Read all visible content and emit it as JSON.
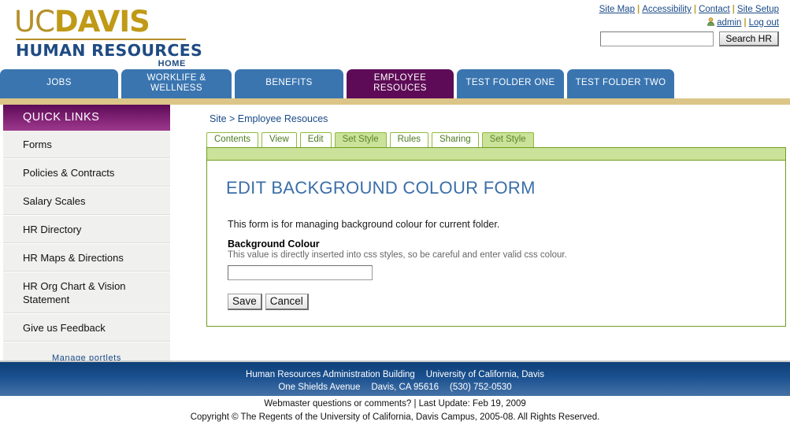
{
  "header": {
    "logo": {
      "uc": "UC",
      "davis": "DAVIS",
      "unit": "HUMAN RESOURCES",
      "home": "HOME"
    },
    "util_links_row1": [
      {
        "label": "Site Map"
      },
      {
        "label": "Accessibility"
      },
      {
        "label": "Contact"
      },
      {
        "label": "Site Setup"
      }
    ],
    "util_links_row2": [
      {
        "label": "admin",
        "icon": "user-icon"
      },
      {
        "label": "Log out"
      }
    ],
    "search": {
      "value": "",
      "placeholder": "",
      "button_label": "Search HR"
    }
  },
  "main_nav": {
    "tabs": [
      {
        "label": "JOBS",
        "active": false
      },
      {
        "label": "WORKLIFE &\nWELLNESS",
        "active": false
      },
      {
        "label": "BENEFITS",
        "active": false
      },
      {
        "label": "EMPLOYEE\nRESOUCES",
        "active": true
      },
      {
        "label": "TEST FOLDER ONE",
        "active": false
      },
      {
        "label": "TEST FOLDER TWO",
        "active": false
      }
    ]
  },
  "sidebar": {
    "title": "QUICK LINKS",
    "items": [
      {
        "label": "Forms"
      },
      {
        "label": "Policies & Contracts"
      },
      {
        "label": "Salary Scales"
      },
      {
        "label": "HR Directory"
      },
      {
        "label": "HR Maps & Directions"
      },
      {
        "label": "HR Org Chart & Vision Statement"
      },
      {
        "label": "Give us Feedback"
      }
    ],
    "manage_portlets": "Manage portlets"
  },
  "content": {
    "breadcrumb": "Site > Employee Resouces",
    "tabs": [
      {
        "label": "Contents",
        "selected": false
      },
      {
        "label": "View",
        "selected": false
      },
      {
        "label": "Edit",
        "selected": false
      },
      {
        "label": "Set Style",
        "selected": true
      },
      {
        "label": "Rules",
        "selected": false
      },
      {
        "label": "Sharing",
        "selected": false
      },
      {
        "label": "Set Style",
        "selected": true
      }
    ],
    "form": {
      "title": "EDIT BACKGROUND COLOUR FORM",
      "intro": "This form is for managing background colour for current folder.",
      "field_label": "Background Colour",
      "field_help": "This value is directly inserted into css styles, so be careful and enter valid css colour.",
      "field_value": "",
      "field_placeholder": "",
      "save_label": "Save",
      "cancel_label": "Cancel"
    }
  },
  "footer": {
    "line1a": "Human Resources Administration Building",
    "line1b": "University of California, Davis",
    "line2a": "One Shields Avenue",
    "line2b": "Davis, CA 95616",
    "line2c": "(530) 752-0530",
    "legal1": "Webmaster questions or comments? | Last Update: Feb 19, 2009",
    "legal2": "Copyright © The Regents of the University of California, Davis Campus, 2005-08. All Rights Reserved."
  },
  "colors": {
    "gold": "#b5902a",
    "navy": "#1f4b82",
    "nav_blue": "#3a75b0",
    "nav_active_purple": "#5d0b56",
    "gold_bar": "#dcc588",
    "green_border": "#6f9e21",
    "green_fill": "#cbe29a",
    "heading_blue": "#3a6ea8",
    "link_blue": "#1a4a86"
  }
}
